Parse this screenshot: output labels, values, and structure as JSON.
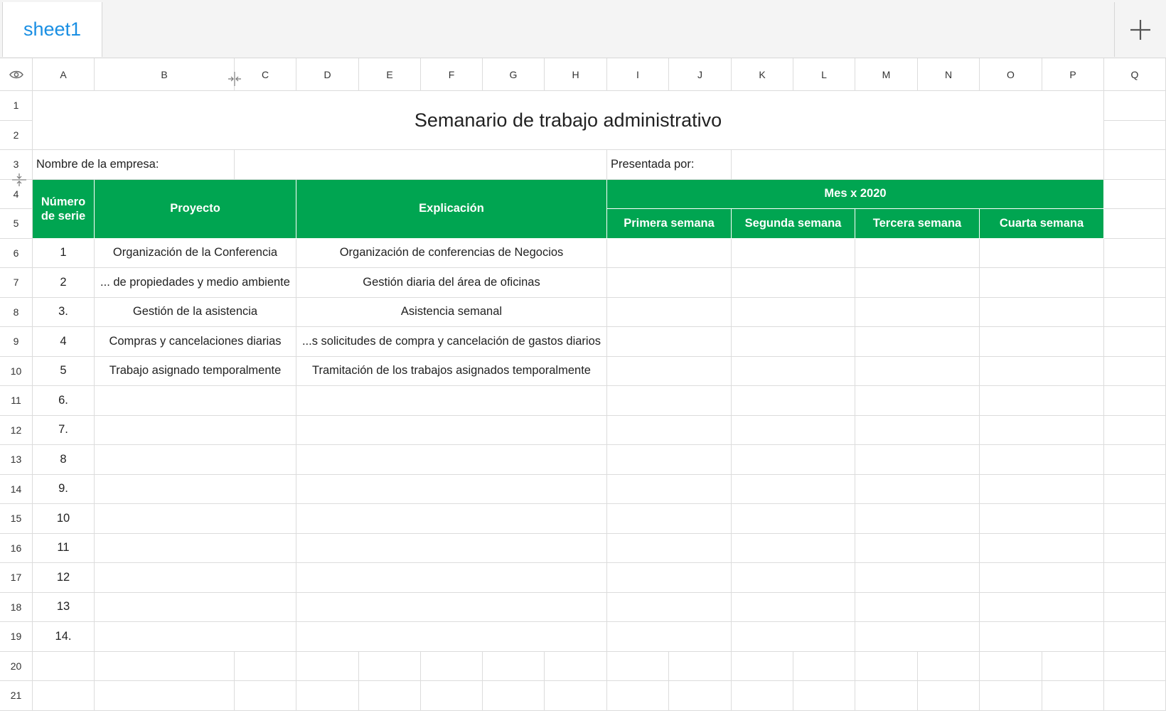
{
  "tabs": [
    {
      "label": "sheet1",
      "color": "#1a8fe3"
    }
  ],
  "columns": [
    "A",
    "B",
    "C",
    "D",
    "E",
    "F",
    "G",
    "H",
    "I",
    "J",
    "K",
    "L",
    "M",
    "N",
    "O",
    "P",
    "Q"
  ],
  "rows": [
    "1",
    "2",
    "3",
    "4",
    "5",
    "6",
    "7",
    "8",
    "9",
    "10",
    "11",
    "12",
    "13",
    "14",
    "15",
    "16",
    "17",
    "18",
    "19",
    "20",
    "21"
  ],
  "sheet": {
    "title": "Semanario de trabajo administrativo",
    "company_label": "Nombre de la empresa:",
    "presented_label": "Presentada por:",
    "header": {
      "serial": "Número de serie",
      "project": "Proyecto",
      "explanation": "Explicación",
      "month": "Mes x 2020",
      "weeks": [
        "Primera semana",
        "Segunda semana",
        "Tercera semana",
        "Cuarta semana"
      ]
    },
    "accent_color": "#00a551",
    "items": [
      {
        "num": "1",
        "project": "Organización de la Conferencia",
        "explanation": "Organización de conferencias de Negocios"
      },
      {
        "num": "2",
        "project": "... de propiedades y medio ambiente",
        "explanation": "Gestión diaria del área de oficinas"
      },
      {
        "num": "3.",
        "project": "Gestión de la asistencia",
        "explanation": "Asistencia semanal"
      },
      {
        "num": "4",
        "project": "Compras y cancelaciones diarias",
        "explanation": "...s solicitudes de compra y cancelación de gastos diarios"
      },
      {
        "num": "5",
        "project": "Trabajo asignado temporalmente",
        "explanation": "Tramitación de los trabajos asignados temporalmente"
      },
      {
        "num": "6.",
        "project": "",
        "explanation": ""
      },
      {
        "num": "7.",
        "project": "",
        "explanation": ""
      },
      {
        "num": "8",
        "project": "",
        "explanation": ""
      },
      {
        "num": "9.",
        "project": "",
        "explanation": ""
      },
      {
        "num": "10",
        "project": "",
        "explanation": ""
      },
      {
        "num": "11",
        "project": "",
        "explanation": ""
      },
      {
        "num": "12",
        "project": "",
        "explanation": ""
      },
      {
        "num": "13",
        "project": "",
        "explanation": ""
      },
      {
        "num": "14.",
        "project": "",
        "explanation": ""
      }
    ]
  },
  "icons": {
    "corner": "eye-icon",
    "add": "plus-icon",
    "col_resize": "column-resize-icon",
    "row_resize": "row-resize-icon"
  }
}
